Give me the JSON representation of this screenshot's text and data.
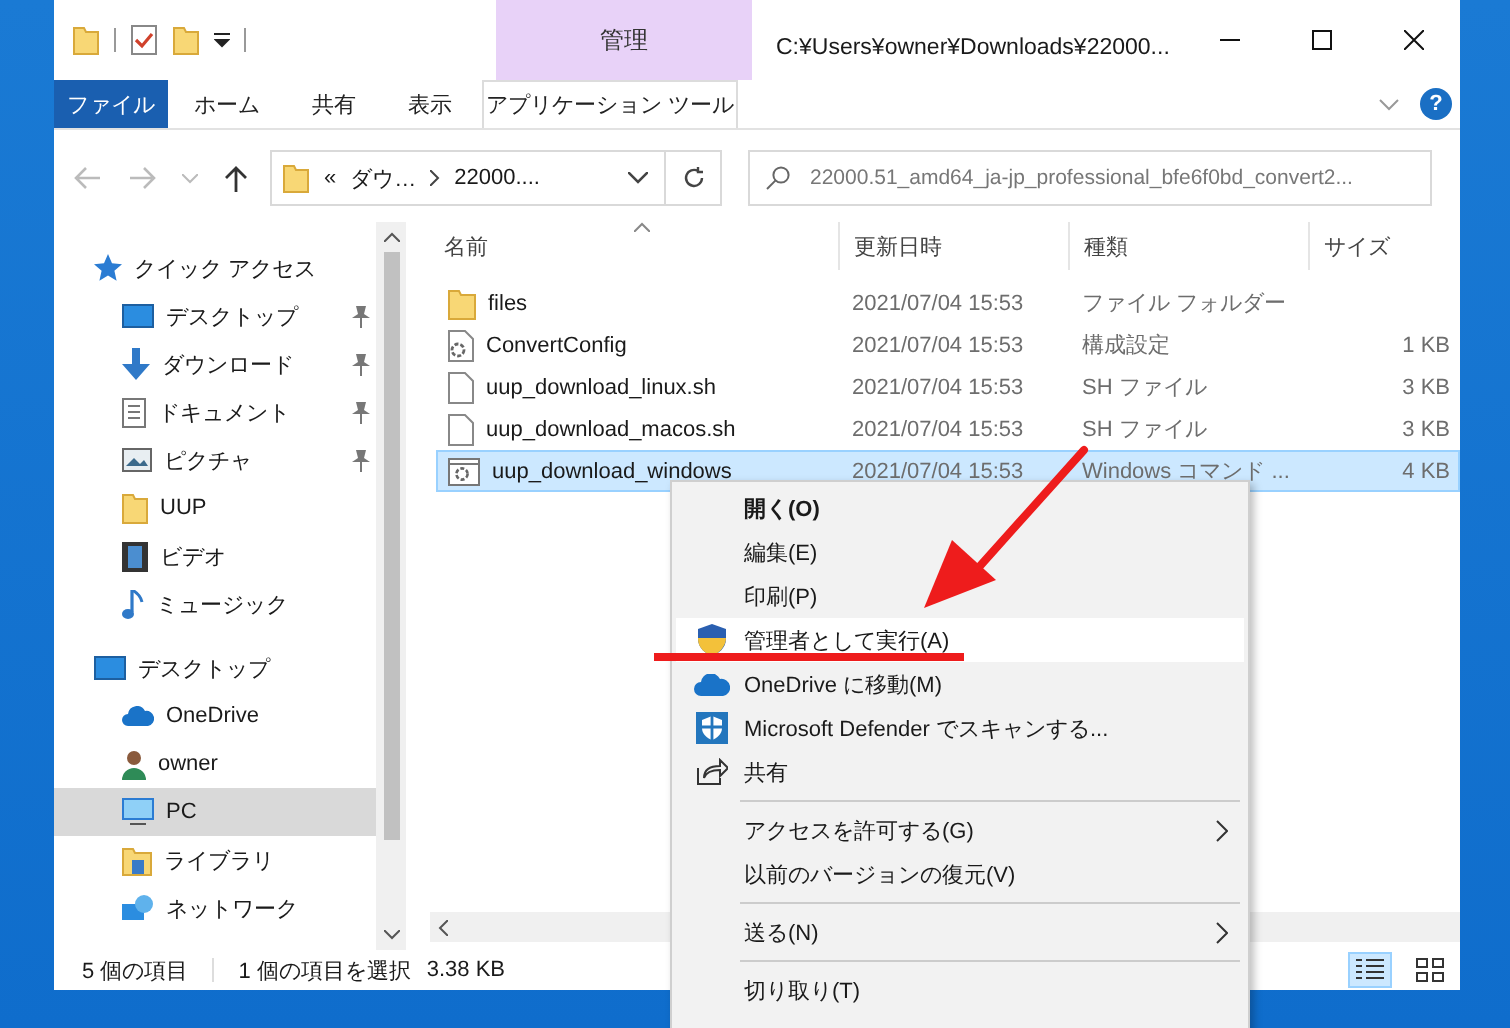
{
  "window": {
    "title": "C:¥Users¥owner¥Downloads¥22000..."
  },
  "ribbon": {
    "context_group": "管理",
    "help": "?",
    "tabs": [
      {
        "label": "ファイル",
        "kind": "file",
        "selected": false
      },
      {
        "label": "ホーム",
        "kind": "tab",
        "selected": false
      },
      {
        "label": "共有",
        "kind": "tab",
        "selected": false
      },
      {
        "label": "表示",
        "kind": "tab",
        "selected": false
      },
      {
        "label": "アプリケーション ツール",
        "kind": "context",
        "selected": false
      }
    ]
  },
  "address_bar": {
    "overflow": "«",
    "crumbs": [
      "ダウ…",
      "22000...."
    ]
  },
  "search": {
    "placeholder": "22000.51_amd64_ja-jp_professional_bfe6f0bd_convert2..."
  },
  "sidebar": {
    "items": [
      {
        "label": "クイック アクセス",
        "kind": "star",
        "selected": false,
        "children": [
          {
            "label": "デスクトップ",
            "kind": "desktop",
            "pinned": true,
            "selected": false
          },
          {
            "label": "ダウンロード",
            "kind": "download",
            "pinned": true,
            "selected": false
          },
          {
            "label": "ドキュメント",
            "kind": "document",
            "pinned": true,
            "selected": false
          },
          {
            "label": "ピクチャ",
            "kind": "picture",
            "pinned": true,
            "selected": false
          },
          {
            "label": "UUP",
            "kind": "folder",
            "pinned": false,
            "selected": false
          },
          {
            "label": "ビデオ",
            "kind": "video",
            "pinned": false,
            "selected": false
          },
          {
            "label": "ミュージック",
            "kind": "music",
            "pinned": false,
            "selected": false
          }
        ]
      },
      {
        "label": "デスクトップ",
        "kind": "desktop",
        "selected": false,
        "children": [
          {
            "label": "OneDrive",
            "kind": "cloud",
            "pinned": false,
            "selected": false
          },
          {
            "label": "owner",
            "kind": "user",
            "pinned": false,
            "selected": false
          },
          {
            "label": "PC",
            "kind": "pc",
            "pinned": false,
            "selected": true
          },
          {
            "label": "ライブラリ",
            "kind": "library",
            "pinned": false,
            "selected": false
          },
          {
            "label": "ネットワーク",
            "kind": "network",
            "pinned": false,
            "selected": false
          }
        ]
      }
    ]
  },
  "files": {
    "columns": [
      "名前",
      "更新日時",
      "種類",
      "サイズ"
    ],
    "rows": [
      {
        "name": "files",
        "date": "2021/07/04 15:53",
        "type": "ファイル フォルダー",
        "size": "",
        "kind": "folder",
        "selected": false
      },
      {
        "name": "ConvertConfig",
        "date": "2021/07/04 15:53",
        "type": "構成設定",
        "size": "1 KB",
        "kind": "config",
        "selected": false
      },
      {
        "name": "uup_download_linux.sh",
        "date": "2021/07/04 15:53",
        "type": "SH ファイル",
        "size": "3 KB",
        "kind": "file",
        "selected": false
      },
      {
        "name": "uup_download_macos.sh",
        "date": "2021/07/04 15:53",
        "type": "SH ファイル",
        "size": "3 KB",
        "kind": "file",
        "selected": false
      },
      {
        "name": "uup_download_windows",
        "date": "2021/07/04 15:53",
        "type": "Windows コマンド ...",
        "size": "4 KB",
        "kind": "script",
        "selected": true
      }
    ]
  },
  "context_menu": {
    "items": [
      {
        "kind": "plain",
        "label": "開く(O)",
        "bold": true,
        "submenu": false,
        "selected": false
      },
      {
        "kind": "plain",
        "label": "編集(E)",
        "bold": false,
        "submenu": false,
        "selected": false
      },
      {
        "kind": "plain",
        "label": "印刷(P)",
        "bold": false,
        "submenu": false,
        "selected": false
      },
      {
        "kind": "shield",
        "label": "管理者として実行(A)",
        "bold": false,
        "submenu": false,
        "selected": true
      },
      {
        "kind": "cloud",
        "label": "OneDrive に移動(M)",
        "bold": false,
        "submenu": false,
        "selected": false
      },
      {
        "kind": "defender",
        "label": "Microsoft Defender でスキャンする...",
        "bold": false,
        "submenu": false,
        "selected": false
      },
      {
        "kind": "share",
        "label": "共有",
        "bold": false,
        "submenu": false,
        "selected": false
      },
      {
        "kind": "separator"
      },
      {
        "kind": "plain",
        "label": "アクセスを許可する(G)",
        "bold": false,
        "submenu": true,
        "selected": false
      },
      {
        "kind": "plain",
        "label": "以前のバージョンの復元(V)",
        "bold": false,
        "submenu": false,
        "selected": false
      },
      {
        "kind": "separator"
      },
      {
        "kind": "plain",
        "label": "送る(N)",
        "bold": false,
        "submenu": true,
        "selected": false
      },
      {
        "kind": "separator"
      },
      {
        "kind": "plain",
        "label": "切り取り(T)",
        "bold": false,
        "submenu": false,
        "selected": false
      }
    ]
  },
  "status_bar": {
    "count": "5 個の項目",
    "selection": "1 個の項目を選択",
    "size": "3.38 KB"
  }
}
